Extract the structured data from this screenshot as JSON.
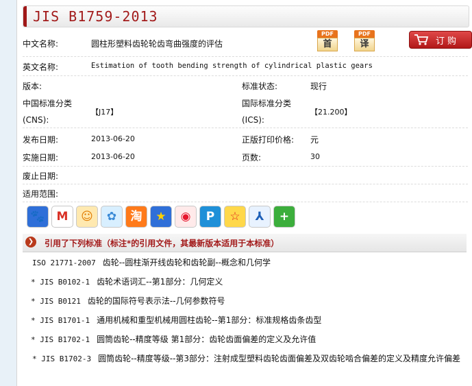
{
  "title": "JIS B1759-2013",
  "fields": {
    "cn_name_label": "中文名称:",
    "cn_name": "圆柱形塑料齿轮轮齿弯曲强度的评估",
    "en_name_label": "英文名称:",
    "en_name": "Estimation of tooth bending strength of cylindrical plastic gears",
    "version_label": "版本:",
    "version": "",
    "status_label": "标准状态:",
    "status": "现行",
    "cns_label_1": "中国标准分类",
    "cns_label_2": "(CNS):",
    "cns": "【J17】",
    "ics_label_1": "国际标准分类",
    "ics_label_2": "(ICS):",
    "ics": "【21.200】",
    "publish_label": "发布日期:",
    "publish": "2013-06-20",
    "price_label": "正版打印价格:",
    "price": "元",
    "implement_label": "实施日期:",
    "implement": "2013-06-20",
    "pages_label": "页数:",
    "pages": "30",
    "abolish_label": "废止日期:",
    "abolish": "",
    "scope_label": "适用范围:",
    "scope": ""
  },
  "actions": {
    "pdf_tag": "PDF",
    "first_label": "首",
    "translate_label": "译",
    "order_label": "订购"
  },
  "share_icons": [
    {
      "name": "baidu-paw-icon",
      "glyph": "🐾",
      "bg": "#2f6fd8",
      "fg": "#ffffff"
    },
    {
      "name": "gmail-icon",
      "glyph": "M",
      "bg": "#ffffff",
      "fg": "#d93025"
    },
    {
      "name": "qzone-icon",
      "glyph": "☺",
      "bg": "#ffe9b0",
      "fg": "#e07b00"
    },
    {
      "name": "kaixin-icon",
      "glyph": "✿",
      "bg": "#d8efff",
      "fg": "#3a8ad6"
    },
    {
      "name": "taobao-icon",
      "glyph": "淘",
      "bg": "#ff7a1a",
      "fg": "#ffffff"
    },
    {
      "name": "favorite-star-icon",
      "glyph": "★",
      "bg": "#2f6fd8",
      "fg": "#ffd200"
    },
    {
      "name": "weibo-icon",
      "glyph": "◉",
      "bg": "#ffeaea",
      "fg": "#e6162d"
    },
    {
      "name": "pinterest-icon",
      "glyph": "P",
      "bg": "#1f90d8",
      "fg": "#ffffff"
    },
    {
      "name": "smiley-star-icon",
      "glyph": "☆",
      "bg": "#ffd84a",
      "fg": "#e0241e"
    },
    {
      "name": "renren-icon",
      "glyph": "⅄",
      "bg": "#e8f2ff",
      "fg": "#1c5fb8"
    },
    {
      "name": "more-plus-icon",
      "glyph": "+",
      "bg": "#3cae3c",
      "fg": "#ffffff"
    }
  ],
  "references": {
    "heading": "引用了下列标准（标注*的引用文件，其最新版本适用于本标准）",
    "items": [
      {
        "code": "ISO 21771-2007",
        "title": "齿轮--圆柱渐开线齿轮和齿轮副--概念和几何学"
      },
      {
        "code": "* JIS B0102-1",
        "title": "齿轮术语词汇--第1部分：几何定义"
      },
      {
        "code": "* JIS B0121",
        "title": "齿轮的国际符号表示法--几何参数符号"
      },
      {
        "code": "* JIS B1701-1",
        "title": "通用机械和重型机械用圆柱齿轮--第1部分：标准规格齿条齿型"
      },
      {
        "code": "* JIS B1702-1",
        "title": "圆筒齿轮--精度等级 第1部分：齿轮齿面偏差的定义及允许值"
      },
      {
        "code": "* JIS B1702-3",
        "title": "圆筒齿轮--精度等级--第3部分：注射成型塑料齿轮齿面偏差及双齿轮啮合偏差的定义及精度允许偏差"
      }
    ]
  }
}
